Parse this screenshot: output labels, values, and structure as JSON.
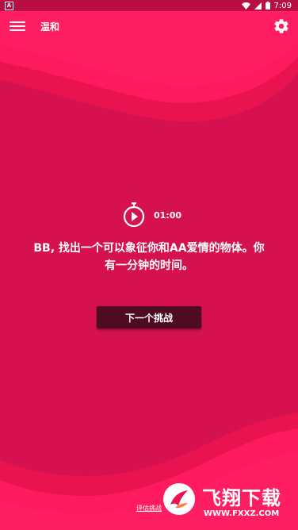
{
  "status_bar": {
    "notification_icon": "A",
    "time": "7:09",
    "icons": [
      "wifi-icon",
      "signal-icon",
      "battery-icon"
    ]
  },
  "toolbar": {
    "title": "温和",
    "menu_icon": "menu-icon",
    "settings_icon": "gear-icon"
  },
  "timer": {
    "icon": "stopwatch-play-icon",
    "value": "01:00"
  },
  "challenge": {
    "text": "BB, 找出一个可以象征你和AA爱情的物体。你有一分钟的时间。"
  },
  "actions": {
    "next_label": "下一个挑战",
    "rate_label": "评估挑战"
  },
  "watermark": {
    "title": "飞翔下载",
    "url": "WWW.FXXZ.COM"
  },
  "colors": {
    "background": "#d6114f",
    "wave": "#ff1a5e",
    "status_bar": "#b80e43",
    "button": "#4f0b22"
  }
}
